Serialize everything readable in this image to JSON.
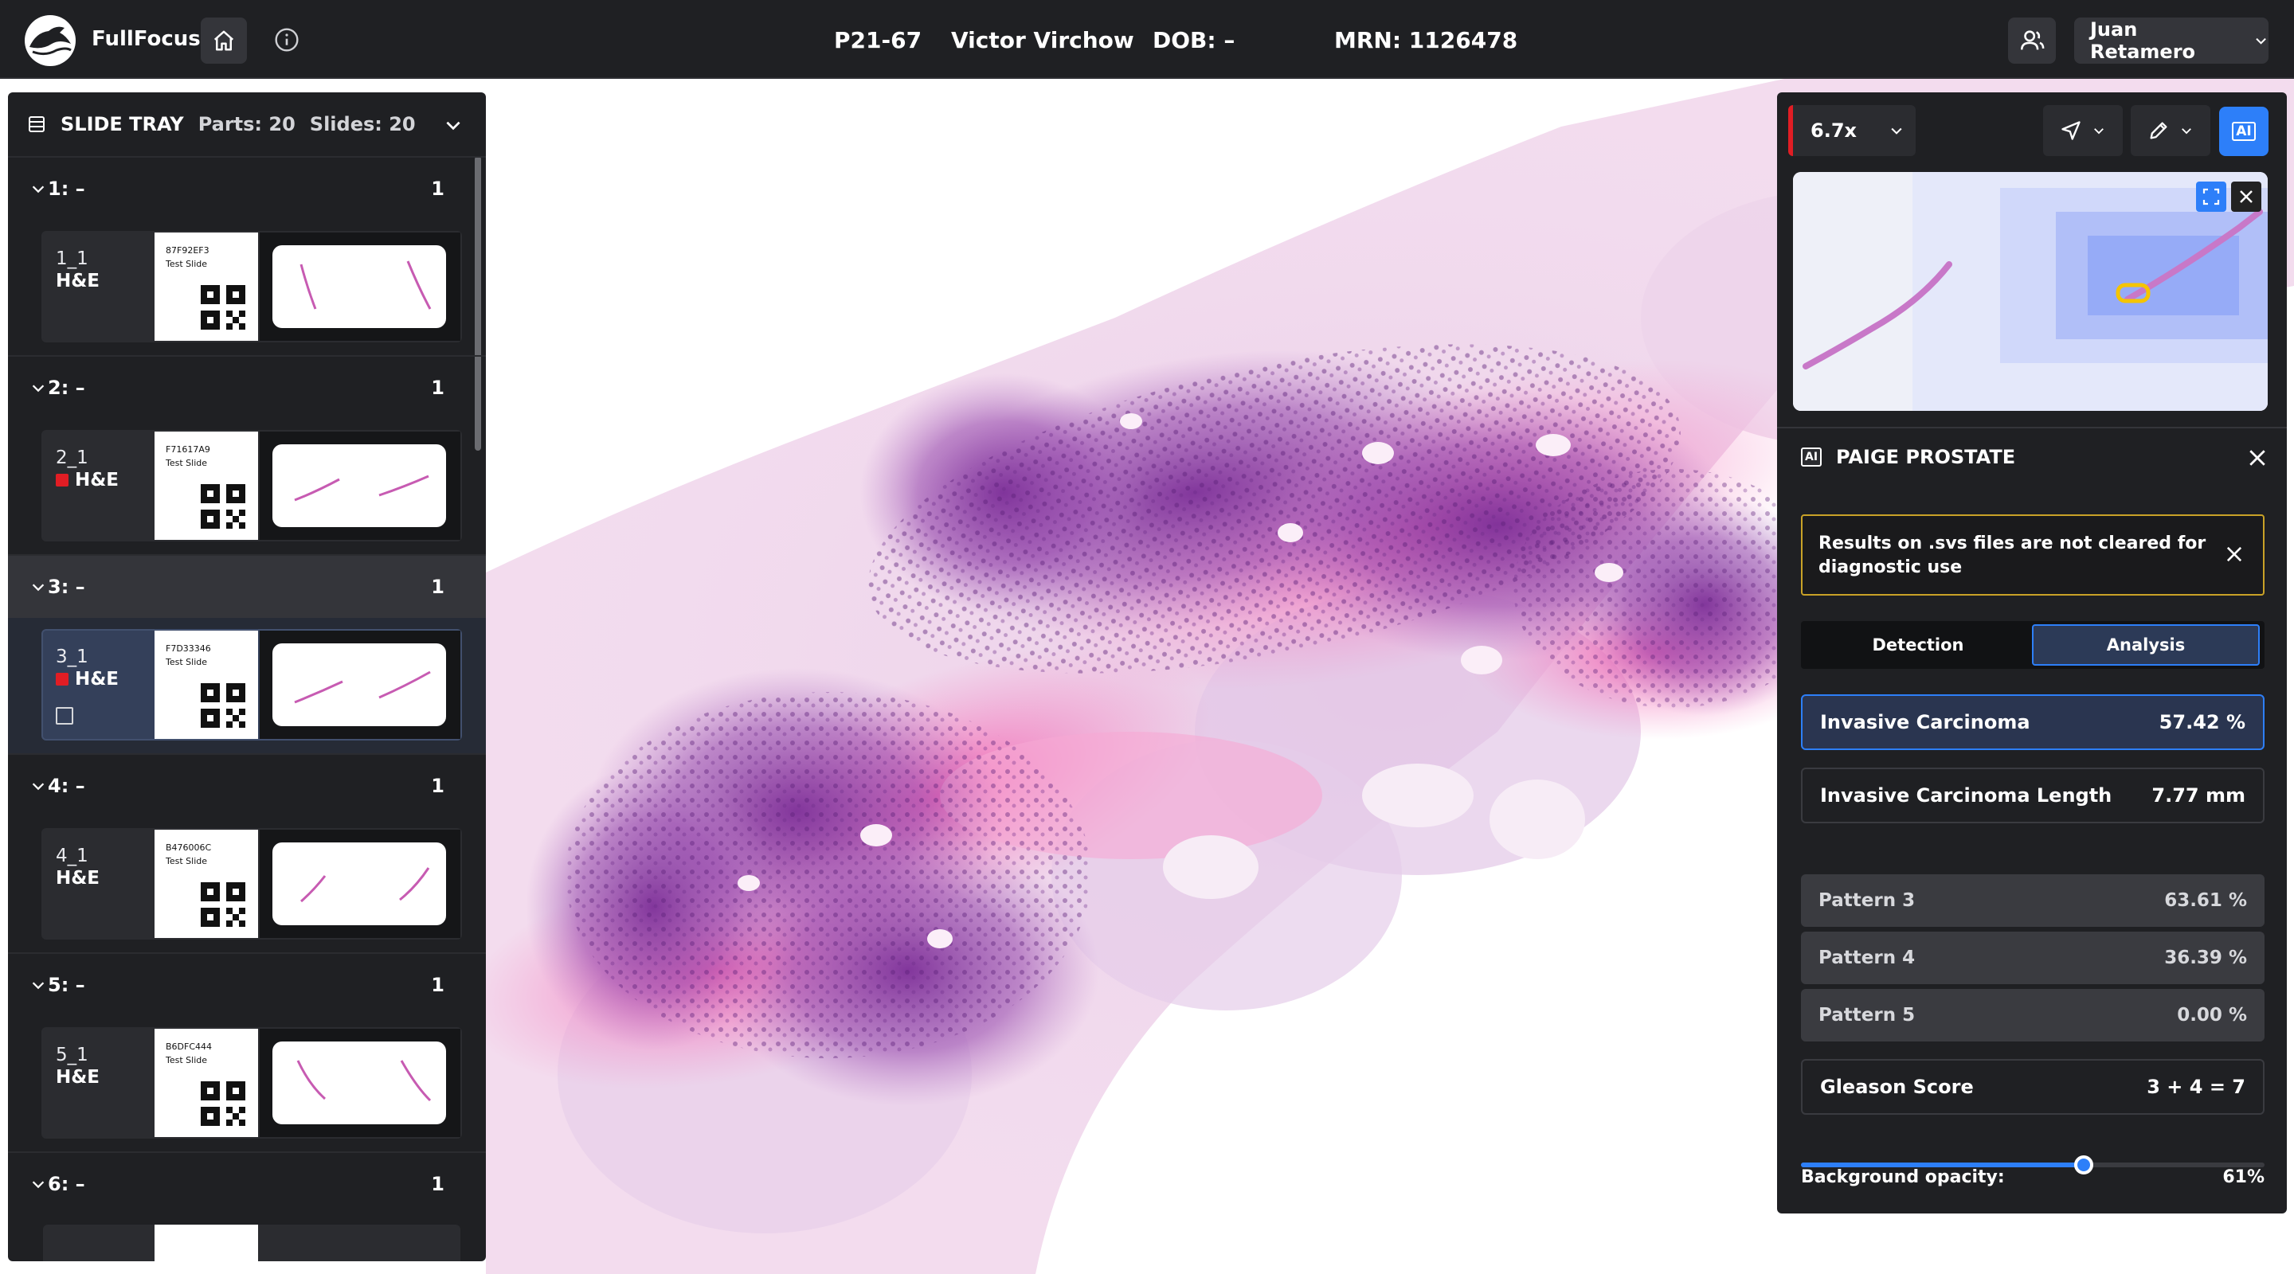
{
  "header": {
    "app_name": "FullFocus",
    "case_id": "P21-67",
    "patient_name": "Victor Virchow",
    "dob": "DOB: –",
    "mrn": "MRN: 1126478",
    "user_name": "Juan Retamero"
  },
  "tray": {
    "title": "SLIDE TRAY",
    "parts_label": "Parts: 20",
    "slides_label": "Slides: 20",
    "parts": [
      {
        "label": "1: –",
        "count": "1",
        "slide_id": "1_1",
        "stain": "H&E",
        "code": "87F92EF3",
        "slide_text": "Test Slide",
        "flag": false,
        "selected": false
      },
      {
        "label": "2: –",
        "count": "1",
        "slide_id": "2_1",
        "stain": "H&E",
        "code": "F71617A9",
        "slide_text": "Test Slide",
        "flag": true,
        "selected": false
      },
      {
        "label": "3: –",
        "count": "1",
        "slide_id": "3_1",
        "stain": "H&E",
        "code": "F7D33346",
        "slide_text": "Test Slide",
        "flag": true,
        "selected": true
      },
      {
        "label": "4: –",
        "count": "1",
        "slide_id": "4_1",
        "stain": "H&E",
        "code": "B476006C",
        "slide_text": "Test Slide",
        "flag": false,
        "selected": false
      },
      {
        "label": "5: –",
        "count": "1",
        "slide_id": "5_1",
        "stain": "H&E",
        "code": "B6DFC444",
        "slide_text": "Test Slide",
        "flag": false,
        "selected": false
      },
      {
        "label": "6: –",
        "count": "1"
      }
    ]
  },
  "toolbar": {
    "zoom": "6.7x",
    "ai_label": "AI"
  },
  "ai_panel": {
    "badge": "AI",
    "title": "PAIGE PROSTATE",
    "warning": "Results on .svs files are not cleared for diagnostic use",
    "tabs": [
      "Detection",
      "Analysis"
    ],
    "active_tab": "Analysis",
    "invasive": {
      "label": "Invasive Carcinoma",
      "value": "57.42 %"
    },
    "length": {
      "label": "Invasive Carcinoma Length",
      "value": "7.77 mm"
    },
    "patterns": [
      {
        "label": "Pattern 3",
        "value": "63.61 %"
      },
      {
        "label": "Pattern 4",
        "value": "36.39 %"
      },
      {
        "label": "Pattern 5",
        "value": "0.00 %"
      }
    ],
    "gleason": {
      "label": "Gleason Score",
      "value": "3 + 4 = 7"
    },
    "opacity": {
      "label": "Background opacity:",
      "value": "61%",
      "fraction": 0.61
    }
  },
  "colors": {
    "accent": "#2d7ff9",
    "panel": "#1f2023",
    "flag": "#e11d24",
    "warning_border": "#c9a227",
    "stain_pink": "#f27bbf",
    "stain_purple": "#8a3a9e"
  }
}
